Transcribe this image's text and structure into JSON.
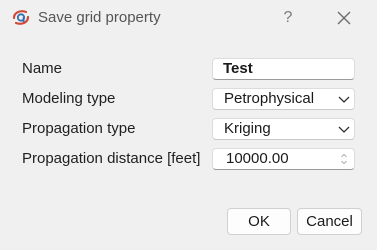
{
  "window": {
    "title": "Save grid property",
    "help_label": "?",
    "app_icon": "app-logo-icon",
    "close_icon": "close-icon"
  },
  "form": {
    "name_label": "Name",
    "name_value": "Test",
    "modeling_type_label": "Modeling type",
    "modeling_type_value": "Petrophysical",
    "propagation_type_label": "Propagation type",
    "propagation_type_value": "Kriging",
    "propagation_distance_label": "Propagation distance [feet]",
    "propagation_distance_value": "10000.00"
  },
  "buttons": {
    "ok_label": "OK",
    "cancel_label": "Cancel"
  },
  "colors": {
    "background": "#f0f0f0",
    "icon_red": "#d04a3a",
    "icon_blue": "#2f6fb3"
  }
}
